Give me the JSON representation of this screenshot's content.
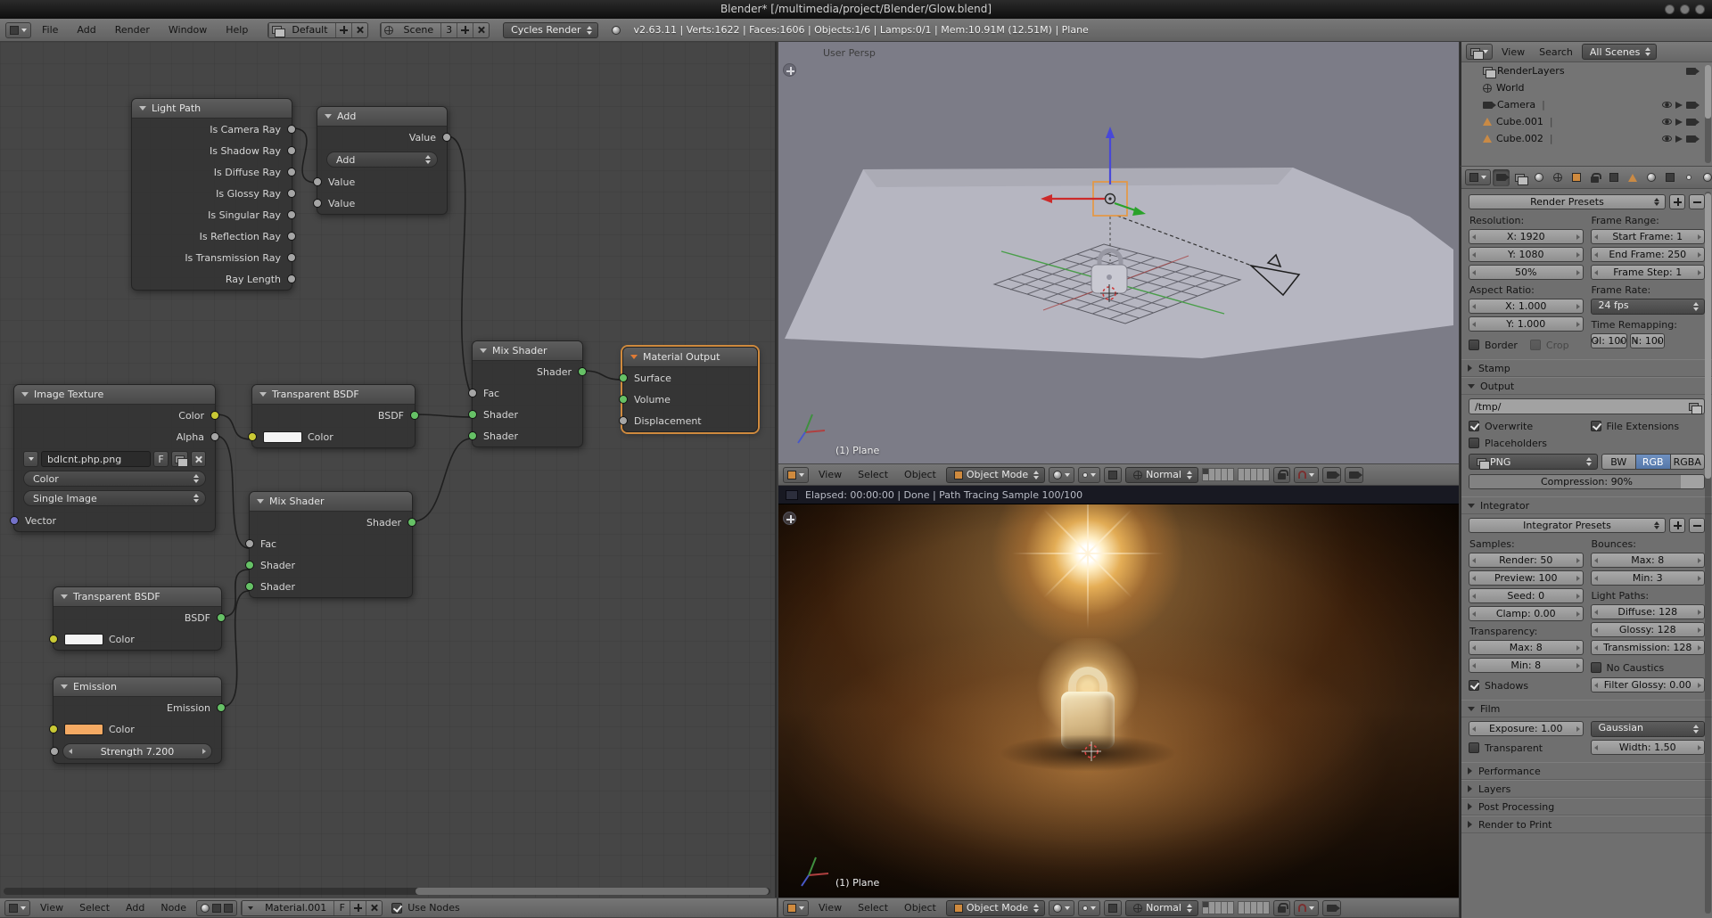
{
  "window": {
    "title": "Blender* [/multimedia/project/Blender/Glow.blend]"
  },
  "menubar": {
    "menus": [
      "File",
      "Add",
      "Render",
      "Window",
      "Help"
    ],
    "layout": "Default",
    "scene": "Scene",
    "scene_users": "3",
    "engine": "Cycles Render",
    "stats": "v2.63.11 | Verts:1622 | Faces:1606 | Objects:1/6 | Lamps:0/1 | Mem:10.91M (12.51M) | Plane"
  },
  "node_editor": {
    "nodes": {
      "light_path": {
        "title": "Light Path",
        "outputs": [
          "Is Camera Ray",
          "Is Shadow Ray",
          "Is Diffuse Ray",
          "Is Glossy Ray",
          "Is Singular Ray",
          "Is Reflection Ray",
          "Is Transmission Ray",
          "Ray Length"
        ]
      },
      "add": {
        "title": "Add",
        "output": "Value",
        "operation": "Add",
        "inputs": [
          "Value",
          "Value"
        ]
      },
      "image_texture": {
        "title": "Image Texture",
        "outputs": [
          "Color",
          "Alpha"
        ],
        "filename": "bdlcnt.php.png",
        "fake_user": "F",
        "color_space": "Color",
        "source": "Single Image",
        "input": "Vector"
      },
      "transparent_top": {
        "title": "Transparent BSDF",
        "output": "BSDF",
        "input": "Color"
      },
      "mix_top": {
        "title": "Mix Shader",
        "output": "Shader",
        "inputs": [
          "Fac",
          "Shader",
          "Shader"
        ]
      },
      "material_output": {
        "title": "Material Output",
        "inputs": [
          "Surface",
          "Volume",
          "Displacement"
        ]
      },
      "mix_bottom": {
        "title": "Mix Shader",
        "output": "Shader",
        "inputs": [
          "Fac",
          "Shader",
          "Shader"
        ]
      },
      "transparent_bottom": {
        "title": "Transparent BSDF",
        "output": "BSDF",
        "input": "Color"
      },
      "emission": {
        "title": "Emission",
        "output": "Emission",
        "input": "Color",
        "strength": "Strength 7.200"
      }
    },
    "footer": {
      "menus": [
        "View",
        "Select",
        "Add",
        "Node"
      ],
      "material": "Material.001",
      "fake_user": "F",
      "use_nodes": "Use Nodes"
    }
  },
  "viewport": {
    "label": "User Persp",
    "object": "(1) Plane",
    "header": {
      "menus": [
        "View",
        "Select",
        "Object"
      ],
      "mode": "Object Mode",
      "orientation": "Normal"
    }
  },
  "render_view": {
    "status": "Elapsed: 00:00:00 | Done | Path Tracing Sample 100/100",
    "object": "(1) Plane",
    "header": {
      "menus": [
        "View",
        "Select",
        "Object"
      ],
      "mode": "Object Mode",
      "orientation": "Normal"
    }
  },
  "outliner": {
    "header": {
      "view": "View",
      "search": "Search",
      "scenes": "All Scenes"
    },
    "sep": "|",
    "items": [
      "RenderLayers",
      "World",
      "Camera",
      "Cube.001",
      "Cube.002"
    ]
  },
  "properties": {
    "presets": "Render Presets",
    "dimensions": {
      "resolution_label": "Resolution:",
      "res_x": "X: 1920",
      "res_y": "Y: 1080",
      "res_pct": "50%",
      "frame_range_label": "Frame Range:",
      "start": "Start Frame: 1",
      "end": "End Frame: 250",
      "step": "Frame Step: 1",
      "aspect_label": "Aspect Ratio:",
      "asp_x": "X: 1.000",
      "asp_y": "Y: 1.000",
      "frame_rate_label": "Frame Rate:",
      "fps": "24 fps",
      "time_remap_label": "Time Remapping:",
      "remap_old": "Ol: 100",
      "remap_new": "N: 100",
      "border": "Border",
      "crop": "Crop"
    },
    "stamp": "Stamp",
    "output": {
      "title": "Output",
      "path": "/tmp/",
      "overwrite": "Overwrite",
      "file_extensions": "File Extensions",
      "placeholders": "Placeholders",
      "format": "PNG",
      "bw": "BW",
      "rgb": "RGB",
      "rgba": "RGBA",
      "compression": "Compression: 90%"
    },
    "integrator": {
      "title": "Integrator",
      "presets": "Integrator Presets",
      "samples_label": "Samples:",
      "render": "Render: 50",
      "preview": "Preview: 100",
      "seed": "Seed: 0",
      "clamp": "Clamp: 0.00",
      "bounces_label": "Bounces:",
      "bounce_max": "Max: 8",
      "bounce_min": "Min: 3",
      "light_paths_label": "Light Paths:",
      "diffuse": "Diffuse: 128",
      "glossy": "Glossy: 128",
      "transmission": "Transmission: 128",
      "no_caustics": "No Caustics",
      "filter_glossy": "Filter Glossy: 0.00",
      "transparency_label": "Transparency:",
      "trans_max": "Max: 8",
      "trans_min": "Min: 8",
      "shadows": "Shadows"
    },
    "film": {
      "title": "Film",
      "exposure": "Exposure: 1.00",
      "filter_type": "Gaussian",
      "transparent": "Transparent",
      "width": "Width: 1.50"
    },
    "collapsed": [
      "Performance",
      "Layers",
      "Post Processing",
      "Render to Print"
    ]
  }
}
